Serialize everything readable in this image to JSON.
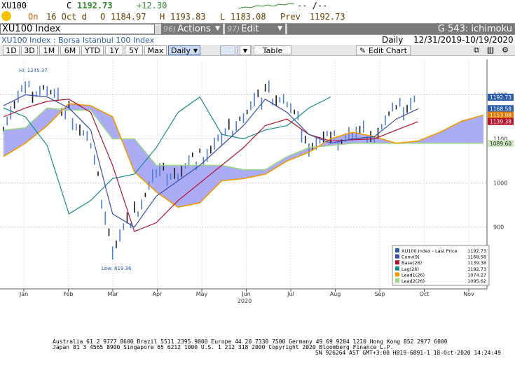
{
  "header": {
    "ticker": "XU100",
    "c_label": "C",
    "last": "1192.73",
    "change": "+12.30",
    "dashes": "-- /--",
    "on_label": "On",
    "date": "16 Oct d",
    "o_label": "O",
    "open": "1184.97",
    "h_label": "H",
    "high": "1193.83",
    "l_label": "L",
    "low": "1183.08",
    "prev_label": "Prev",
    "prev": "1192.73"
  },
  "toolbar": {
    "security": "XU100 Index",
    "actions_num": "96)",
    "actions": "Actions",
    "edit_num": "97)",
    "edit": "Edit",
    "chart_id": "G 543: ichimoku"
  },
  "subheader": {
    "title": "XU100 Index : Borsa Istanbul 100 Index",
    "period": "Daily",
    "range": "12/31/2019-10/19/2020"
  },
  "ranges": [
    "1D",
    "3D",
    "1M",
    "6M",
    "YTD",
    "1Y",
    "5Y",
    "Max"
  ],
  "freq": "Daily",
  "table_btn": "Table",
  "edit_chart_btn": "Edit Chart",
  "colors": {
    "price_bar": "#1a1a1a",
    "price_bar_up": "#4d7fd6",
    "conv": "#3a4fb0",
    "base": "#b3122c",
    "lag": "#1a8a8a",
    "lead1": "#f29a00",
    "lead2": "#9dd68a",
    "cloud": "#9d9df5"
  },
  "chart_data": {
    "type": "line",
    "title": "",
    "xlabel": "2020",
    "ylabel": "",
    "x_ticks": [
      "Jan",
      "Feb",
      "Mar",
      "Apr",
      "May",
      "Jun",
      "Jul",
      "Aug",
      "Sep",
      "Oct",
      "Nov"
    ],
    "y_ticks": [
      "900",
      "1000",
      "1100",
      "1200"
    ],
    "ylim": [
      760,
      1280
    ],
    "hi_label": "Hi: 1245.37",
    "low_label": "Low: 819.36",
    "axis_tags": [
      {
        "value": "1192.73",
        "color": "#2a5aa8"
      },
      {
        "value": "1168.58",
        "color": "#2a5aa8"
      },
      {
        "value": "1153.98",
        "color": "#e07800"
      },
      {
        "value": "1139.38",
        "color": "#b3122c"
      },
      {
        "value": "1089.60",
        "color": "#cde8c0"
      }
    ],
    "x": [
      "Jan 01",
      "Jan 15",
      "Feb 01",
      "Feb 15",
      "Mar 01",
      "Mar 15",
      "Apr 01",
      "Apr 15",
      "May 01",
      "May 15",
      "Jun 01",
      "Jun 15",
      "Jul 01",
      "Jul 15",
      "Aug 01",
      "Aug 15",
      "Sep 01",
      "Sep 15",
      "Oct 01",
      "Oct 16",
      "Nov 01",
      "Nov 15",
      "Nov 30"
    ],
    "series": [
      {
        "name": "XU100 Index - Last Price",
        "values": [
          1140,
          1210,
          1215,
          1160,
          1080,
          850,
          930,
          1020,
          1025,
          1060,
          1100,
          1160,
          1205,
          1180,
          1090,
          1095,
          1110,
          1115,
          1165,
          1193,
          null,
          null,
          null
        ]
      },
      {
        "name": "Conv(9)",
        "values": [
          1175,
          1200,
          1195,
          1170,
          1120,
          930,
          900,
          970,
          1005,
          1040,
          1085,
          1130,
          1190,
          1160,
          1110,
          1090,
          1100,
          1105,
          1145,
          1168,
          null,
          null,
          null
        ]
      },
      {
        "name": "Base(26)",
        "values": [
          1150,
          1170,
          1185,
          1190,
          1160,
          1040,
          890,
          910,
          960,
          1000,
          1040,
          1080,
          1130,
          1145,
          1110,
          1095,
          1098,
          1100,
          1120,
          1139,
          null,
          null,
          null
        ]
      },
      {
        "name": "Lag(26)",
        "values": [
          1170,
          1150,
          1085,
          930,
          960,
          1010,
          1020,
          1080,
          1160,
          1195,
          1110,
          1100,
          1120,
          1130,
          1170,
          1195,
          null,
          null,
          null,
          null,
          null,
          null,
          null
        ]
      },
      {
        "name": "Lead1(26)",
        "values": [
          1060,
          1090,
          1130,
          1180,
          1175,
          1150,
          1025,
          980,
          945,
          955,
          1005,
          1010,
          1020,
          1050,
          1070,
          1100,
          1115,
          1105,
          1090,
          1095,
          1115,
          1140,
          1154
        ]
      },
      {
        "name": "Lead2(26)",
        "values": [
          1120,
          1125,
          1170,
          1165,
          1165,
          1100,
          1100,
          1040,
          1040,
          1040,
          1040,
          1030,
          1030,
          1060,
          1080,
          1085,
          1090,
          1090,
          1090,
          1090,
          1090,
          1090,
          1090
        ]
      }
    ],
    "legend": {
      "position": "bottom-right",
      "entries": [
        {
          "name": "XU100 Index - Last Price",
          "value": "1192.73",
          "color": "#2a5aa8"
        },
        {
          "name": "Conv(9)",
          "value": "1168.58",
          "color": "#3a4fb0"
        },
        {
          "name": "Base(26)",
          "value": "1139.38",
          "color": "#b3122c"
        },
        {
          "name": "Lag(26)",
          "value": "1192.73",
          "color": "#1a8a8a"
        },
        {
          "name": "Lead1(26)",
          "value": "1074.27",
          "color": "#f29a00"
        },
        {
          "name": "Lead2(26)",
          "value": "1095.62",
          "color": "#9dd68a"
        }
      ]
    }
  },
  "footer": {
    "line1": "Australia 61 2 9777 8600 Brazil 5511 2395 9000 Europe 44 20 7330 7500 Germany 49 69 9204 1210 Hong Kong 852 2977 6000",
    "line2": "Japan 81 3 4565 8900         Singapore 65 6212 1000         U.S. 1 212 318 2000            Copyright 2020 Bloomberg Finance L.P.",
    "line3": "SN 926264 AST  GMT+3:00 H819-6891-1 18-Oct-2020 14:24:49"
  }
}
